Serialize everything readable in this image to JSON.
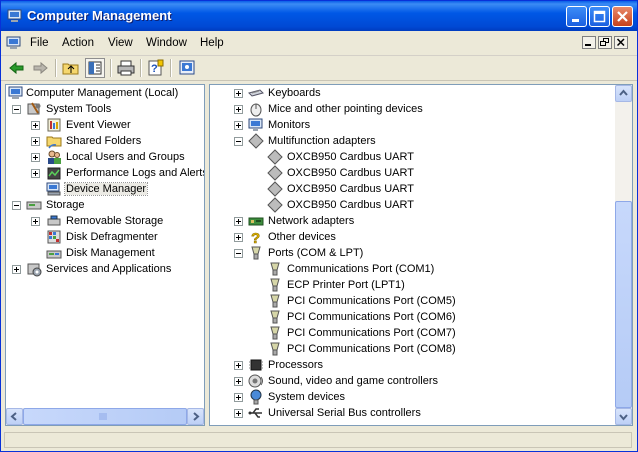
{
  "window": {
    "title": "Computer Management"
  },
  "menu": {
    "items": [
      "File",
      "Action",
      "View",
      "Window",
      "Help"
    ]
  },
  "toolbar": {
    "icons": [
      "back-icon",
      "forward-icon",
      "up-folder-icon",
      "show-hide-tree-icon",
      "print-icon",
      "help-icon",
      "properties-icon"
    ]
  },
  "tree": {
    "root": "Computer Management (Local)",
    "system_tools": "System Tools",
    "event_viewer": "Event Viewer",
    "shared_folders": "Shared Folders",
    "local_users": "Local Users and Groups",
    "perf_logs": "Performance Logs and Alerts",
    "device_manager": "Device Manager",
    "storage": "Storage",
    "removable_storage": "Removable Storage",
    "disk_defrag": "Disk Defragmenter",
    "disk_mgmt": "Disk Management",
    "services": "Services and Applications"
  },
  "devices": {
    "keyboards": "Keyboards",
    "mice": "Mice and other pointing devices",
    "monitors": "Monitors",
    "multifunction": "Multifunction adapters",
    "mf_children": [
      "OXCB950 Cardbus UART",
      "OXCB950 Cardbus UART",
      "OXCB950 Cardbus UART",
      "OXCB950 Cardbus UART"
    ],
    "network": "Network adapters",
    "other": "Other devices",
    "ports": "Ports (COM & LPT)",
    "port_children": [
      "Communications Port (COM1)",
      "ECP Printer Port (LPT1)",
      "PCI Communications Port (COM5)",
      "PCI Communications Port (COM6)",
      "PCI Communications Port (COM7)",
      "PCI Communications Port (COM8)"
    ],
    "processors": "Processors",
    "sound": "Sound, video and game controllers",
    "system": "System devices",
    "usb": "Universal Serial Bus controllers"
  }
}
